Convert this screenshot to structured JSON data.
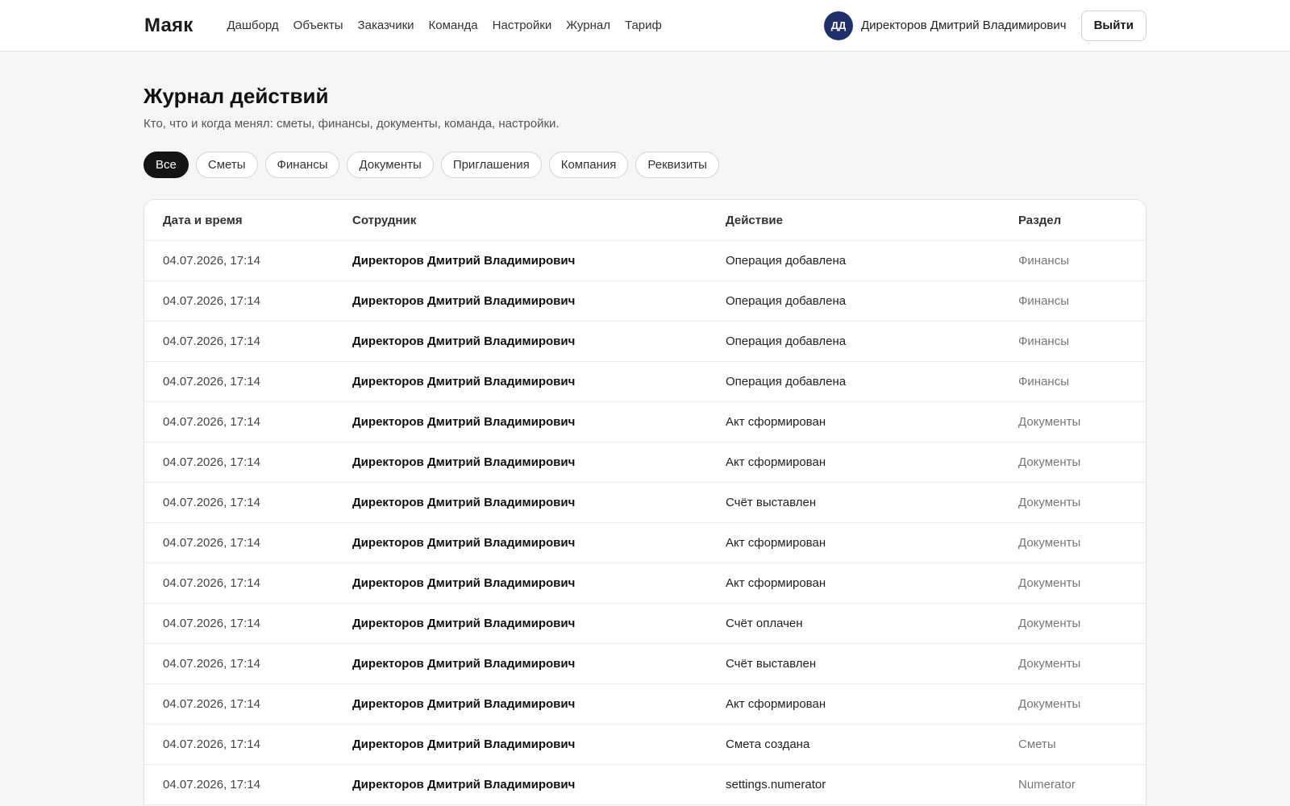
{
  "app": {
    "logo": "Маяк",
    "nav": [
      "Дашборд",
      "Объекты",
      "Заказчики",
      "Команда",
      "Настройки",
      "Журнал",
      "Тариф"
    ],
    "user": {
      "initials": "ДД",
      "name": "Директоров Дмитрий Владимирович",
      "avatar_color": "#1f2f6b"
    },
    "logout_label": "Выйти"
  },
  "page": {
    "title": "Журнал действий",
    "subtitle": "Кто, что и когда менял: сметы, финансы, документы, команда, настройки."
  },
  "filters": {
    "active": "Все",
    "items": [
      "Все",
      "Сметы",
      "Финансы",
      "Документы",
      "Приглашения",
      "Компания",
      "Реквизиты"
    ]
  },
  "table": {
    "columns": [
      "Дата и время",
      "Сотрудник",
      "Действие",
      "Раздел"
    ],
    "rows": [
      [
        "04.07.2026, 17:14",
        "Директоров Дмитрий Владимирович",
        "Операция добавлена",
        "Финансы"
      ],
      [
        "04.07.2026, 17:14",
        "Директоров Дмитрий Владимирович",
        "Операция добавлена",
        "Финансы"
      ],
      [
        "04.07.2026, 17:14",
        "Директоров Дмитрий Владимирович",
        "Операция добавлена",
        "Финансы"
      ],
      [
        "04.07.2026, 17:14",
        "Директоров Дмитрий Владимирович",
        "Операция добавлена",
        "Финансы"
      ],
      [
        "04.07.2026, 17:14",
        "Директоров Дмитрий Владимирович",
        "Акт сформирован",
        "Документы"
      ],
      [
        "04.07.2026, 17:14",
        "Директоров Дмитрий Владимирович",
        "Акт сформирован",
        "Документы"
      ],
      [
        "04.07.2026, 17:14",
        "Директоров Дмитрий Владимирович",
        "Счёт выставлен",
        "Документы"
      ],
      [
        "04.07.2026, 17:14",
        "Директоров Дмитрий Владимирович",
        "Акт сформирован",
        "Документы"
      ],
      [
        "04.07.2026, 17:14",
        "Директоров Дмитрий Владимирович",
        "Акт сформирован",
        "Документы"
      ],
      [
        "04.07.2026, 17:14",
        "Директоров Дмитрий Владимирович",
        "Счёт оплачен",
        "Документы"
      ],
      [
        "04.07.2026, 17:14",
        "Директоров Дмитрий Владимирович",
        "Счёт выставлен",
        "Документы"
      ],
      [
        "04.07.2026, 17:14",
        "Директоров Дмитрий Владимирович",
        "Акт сформирован",
        "Документы"
      ],
      [
        "04.07.2026, 17:14",
        "Директоров Дмитрий Владимирович",
        "Смета создана",
        "Сметы"
      ],
      [
        "04.07.2026, 17:14",
        "Директоров Дмитрий Владимирович",
        "settings.numerator",
        "Numerator"
      ]
    ]
  }
}
